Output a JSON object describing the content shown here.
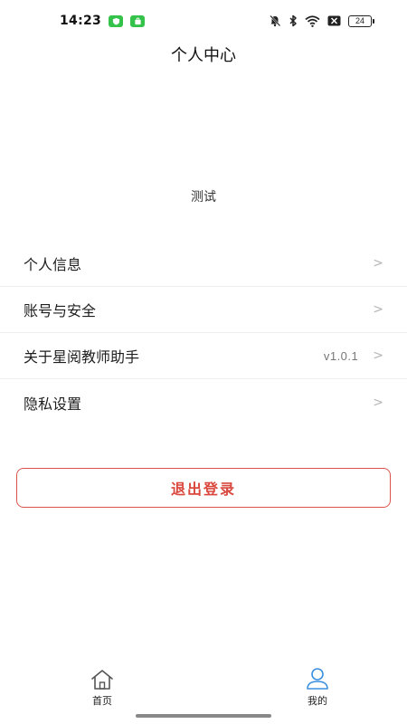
{
  "status_bar": {
    "time": "14:23",
    "battery": "24",
    "icons": [
      "shield-app-icon",
      "store-app-icon",
      "mute-bell-icon",
      "bluetooth-icon",
      "wifi-icon",
      "sim-off-icon",
      "battery-icon"
    ]
  },
  "header": {
    "title": "个人中心"
  },
  "profile": {
    "name": "测试"
  },
  "menu": {
    "items": [
      {
        "label": "个人信息",
        "value": "",
        "chevron": ">"
      },
      {
        "label": "账号与安全",
        "value": "",
        "chevron": ">"
      },
      {
        "label": "关于星阅教师助手",
        "value": "v1.0.1",
        "chevron": ">"
      },
      {
        "label": "隐私设置",
        "value": "",
        "chevron": ">"
      }
    ]
  },
  "logout": {
    "label": "退出登录"
  },
  "colors": {
    "accent": "#d9473d",
    "active_tab": "#3a8fe0",
    "divider": "#eeeeee"
  },
  "tab_bar": {
    "tabs": [
      {
        "label": "首页",
        "icon": "home-icon",
        "active": false
      },
      {
        "label": "我的",
        "icon": "user-icon",
        "active": true
      }
    ]
  }
}
